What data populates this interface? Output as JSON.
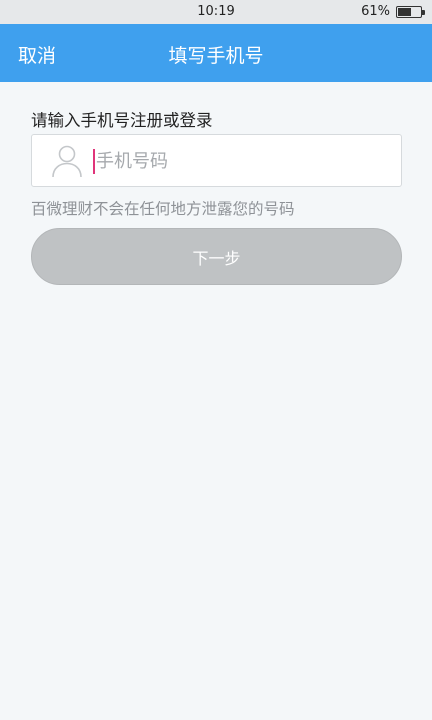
{
  "status_bar": {
    "time": "10:19",
    "battery_percent": "61%",
    "battery_level": 0.61
  },
  "app_bar": {
    "cancel_label": "取消",
    "title": "填写手机号",
    "background_color": "#3fa0ee"
  },
  "form": {
    "prompt": "请输入手机号注册或登录",
    "phone_placeholder": "手机号码",
    "phone_value": "",
    "user_icon": "user-icon",
    "privacy_note": "百微理财不会在任何地方泄露您的号码",
    "next_label": "下一步",
    "next_disabled_color": "#bfc2c4"
  }
}
